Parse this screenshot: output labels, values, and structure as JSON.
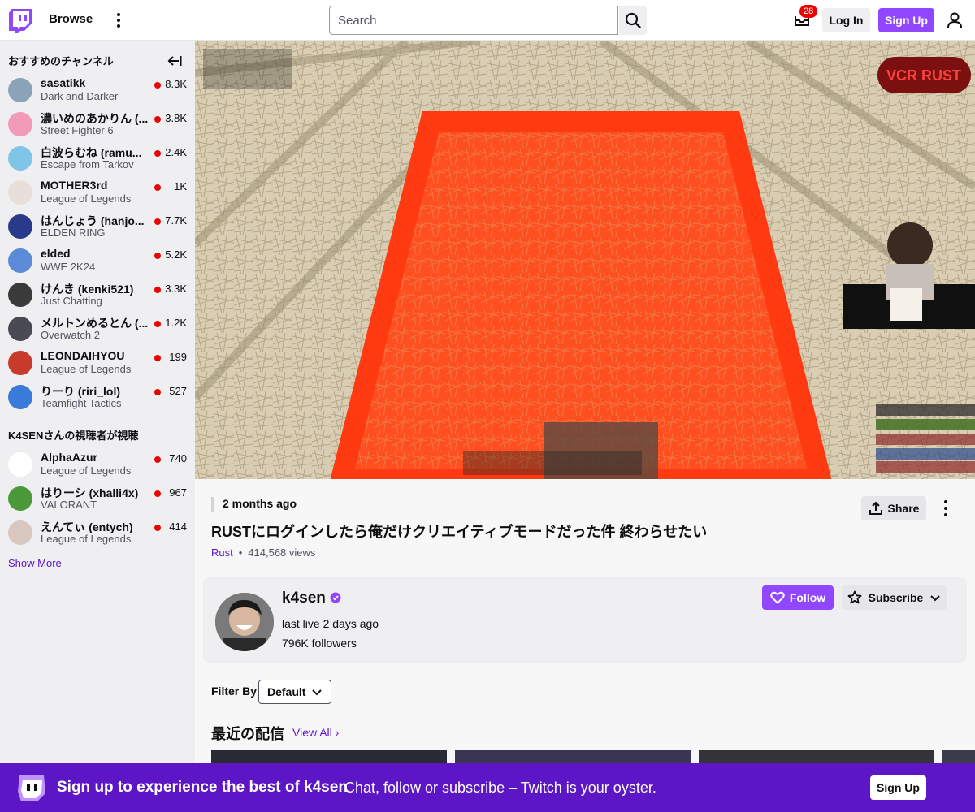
{
  "nav": {
    "browse": "Browse",
    "search_placeholder": "Search",
    "inbox_count": "28",
    "login": "Log In",
    "signup": "Sign Up"
  },
  "sidebar": {
    "recommended_heading": "おすすめのチャンネル",
    "viewers_also_heading": "K4SENさんの視聴者が視聴",
    "show_more": "Show More",
    "recommended": [
      {
        "name": "sasatikk",
        "game": "Dark and Darker",
        "viewers": "8.3K",
        "color": "#8aa3b8"
      },
      {
        "name": "濃いめのあかりん (...",
        "game": "Street Fighter 6",
        "viewers": "3.8K",
        "color": "#f29ab8"
      },
      {
        "name": "白波らむね (ramu...",
        "game": "Escape from Tarkov",
        "viewers": "2.4K",
        "color": "#7fc5e8"
      },
      {
        "name": "MOTHER3rd",
        "game": "League of Legends",
        "viewers": "1K",
        "color": "#e8e0d8"
      },
      {
        "name": "はんじょう (hanjo...",
        "game": "ELDEN RING",
        "viewers": "7.7K",
        "color": "#2a3a8a"
      },
      {
        "name": "elded",
        "game": "WWE 2K24",
        "viewers": "5.2K",
        "color": "#5a8ad8"
      },
      {
        "name": "けんき (kenki521)",
        "game": "Just Chatting",
        "viewers": "3.3K",
        "color": "#3a3a3a"
      },
      {
        "name": "メルトンめるとん (...",
        "game": "Overwatch 2",
        "viewers": "1.2K",
        "color": "#4a4a52"
      },
      {
        "name": "LEONDAIHYOU",
        "game": "League of Legends",
        "viewers": "199",
        "color": "#c83a2a"
      },
      {
        "name": "りーり (riri_lol)",
        "game": "Teamfight Tactics",
        "viewers": "527",
        "color": "#3a7ad8"
      }
    ],
    "also_watching": [
      {
        "name": "AlphaAzur",
        "game": "League of Legends",
        "viewers": "740",
        "color": "#ffffff"
      },
      {
        "name": "はりーシ (xhalli4x)",
        "game": "VALORANT",
        "viewers": "967",
        "color": "#4a9a3a"
      },
      {
        "name": "えんてぃ (entych)",
        "game": "League of Legends",
        "viewers": "414",
        "color": "#d8c8c0"
      }
    ]
  },
  "video": {
    "overlay_brand": "VCR RUST"
  },
  "info": {
    "ago": "2 months ago",
    "share": "Share",
    "title": "RUSTにログインしたら俺だけクリエイティブモードだった件 終わらせたい",
    "game": "Rust",
    "dot": "•",
    "views": "414,568 views"
  },
  "channel": {
    "name": "k4sen",
    "last_live": "last live 2 days ago",
    "followers": "796K followers",
    "follow": "Follow",
    "subscribe": "Subscribe"
  },
  "filter": {
    "label": "Filter By",
    "value": "Default"
  },
  "recent": {
    "heading": "最近の配信",
    "view_all": "View All"
  },
  "banner": {
    "main": "Sign up to experience the best of k4sen",
    "sub": "Chat, follow or subscribe – Twitch is your oyster.",
    "button": "Sign Up"
  }
}
